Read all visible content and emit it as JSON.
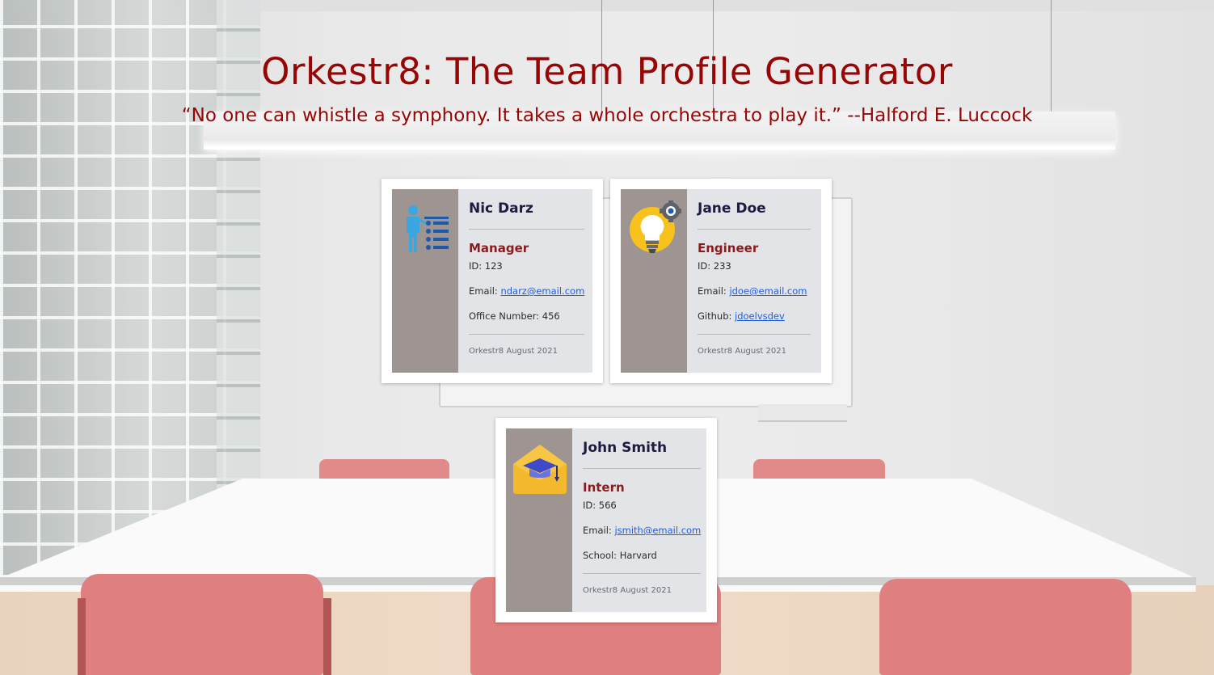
{
  "header": {
    "title": "Orkestr8: The Team Profile Generator",
    "quote": "“No one can whistle a symphony. It takes a whole orchestra to play it.” --Halford E. Luccock"
  },
  "colors": {
    "title": "#980505",
    "card_side": "#9e9592",
    "card_body": "#e2e4e8",
    "role_text": "#8e1b1b",
    "link": "#1f5fe0"
  },
  "employees": [
    {
      "name": "Nic Darz",
      "role": "Manager",
      "icon": "presenter-icon",
      "id_label": "ID: 123",
      "email_prefix": "Email: ",
      "email": "ndarz@email.com",
      "extra_prefix": "Office Number: 456",
      "extra_value": "",
      "footer": "Orkestr8 August 2021"
    },
    {
      "name": "Jane Doe",
      "role": "Engineer",
      "icon": "lightbulb-gear-icon",
      "id_label": "ID: 233",
      "email_prefix": "Email: ",
      "email": "jdoe@email.com",
      "extra_prefix": "Github: ",
      "extra_value": "jdoelvsdev",
      "footer": "Orkestr8 August 2021"
    },
    {
      "name": "John Smith",
      "role": "Intern",
      "icon": "graduation-cap-envelope-icon",
      "id_label": "ID: 566",
      "email_prefix": "Email: ",
      "email": "jsmith@email.com",
      "extra_prefix": "School: Harvard",
      "extra_value": "",
      "footer": "Orkestr8 August 2021"
    }
  ]
}
